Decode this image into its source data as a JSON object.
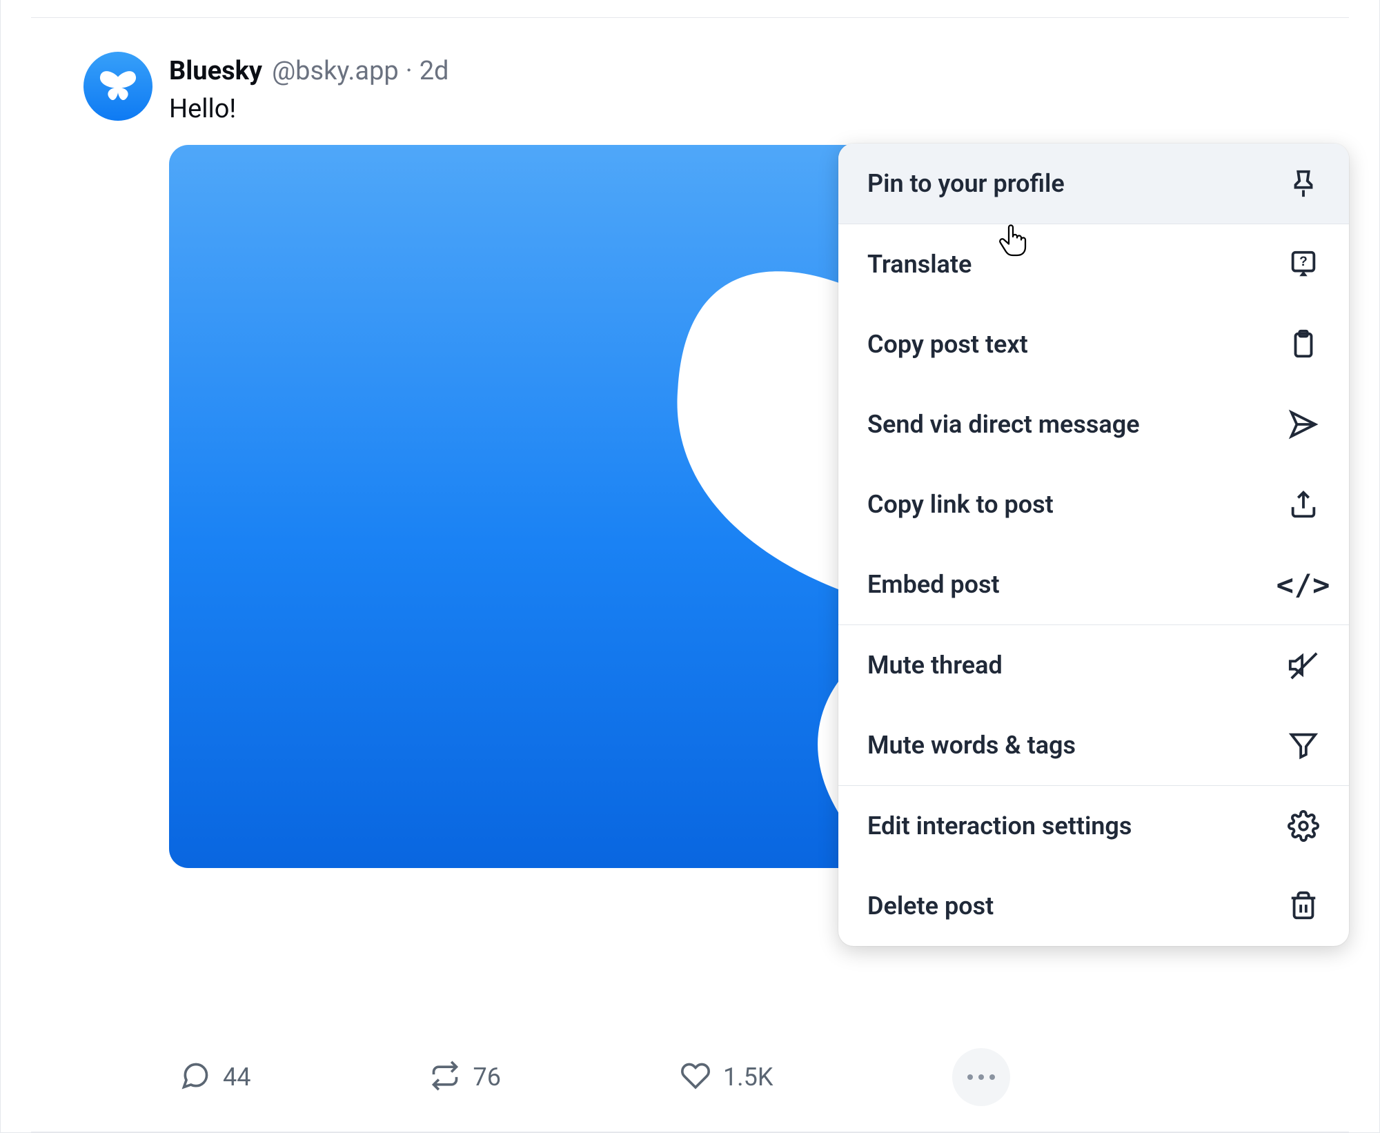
{
  "post": {
    "author": {
      "display_name": "Bluesky",
      "handle": "@bsky.app"
    },
    "time_separator": "·",
    "time": "2d",
    "text": "Hello!"
  },
  "actions": {
    "reply_count": "44",
    "repost_count": "76",
    "like_count": "1.5K"
  },
  "menu": {
    "items": [
      {
        "label": "Pin to your profile",
        "icon": "pin-icon",
        "highlighted": true
      },
      {
        "label": "Translate",
        "icon": "translate-icon"
      },
      {
        "label": "Copy post text",
        "icon": "clipboard-icon"
      },
      {
        "label": "Send via direct message",
        "icon": "send-icon"
      },
      {
        "label": "Copy link to post",
        "icon": "share-icon"
      },
      {
        "label": "Embed post",
        "icon": "code-icon"
      },
      {
        "label": "Mute thread",
        "icon": "mute-icon"
      },
      {
        "label": "Mute words & tags",
        "icon": "filter-icon"
      },
      {
        "label": "Edit interaction settings",
        "icon": "gear-icon"
      },
      {
        "label": "Delete post",
        "icon": "trash-icon"
      }
    ]
  },
  "code_glyph": "</>"
}
